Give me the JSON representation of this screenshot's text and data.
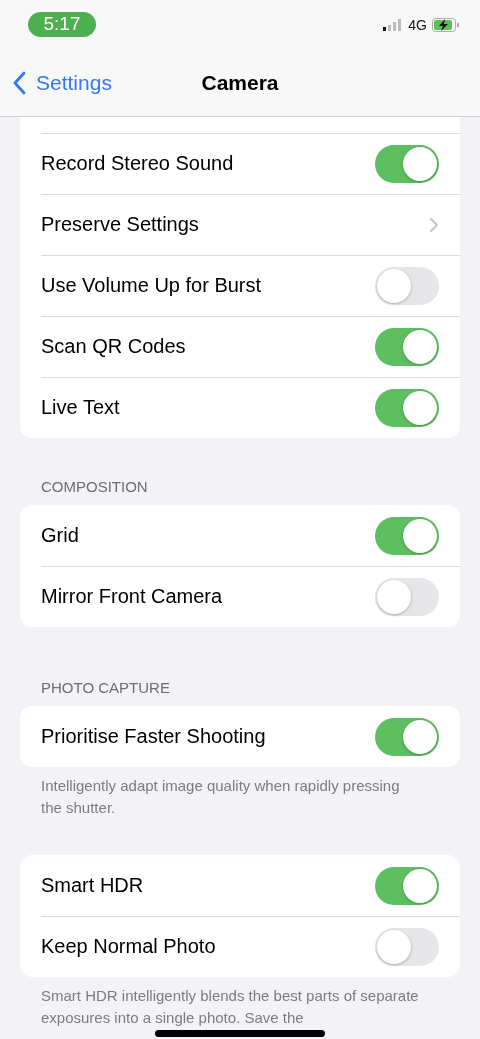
{
  "status_bar": {
    "time": "5:17",
    "network": "4G"
  },
  "nav": {
    "back": "Settings",
    "title": "Camera"
  },
  "groups": [
    {
      "rows": [
        {
          "label": "Record Stereo Sound",
          "kind": "toggle",
          "on": true
        },
        {
          "label": "Preserve Settings",
          "kind": "link"
        },
        {
          "label": "Use Volume Up for Burst",
          "kind": "toggle",
          "on": false
        },
        {
          "label": "Scan QR Codes",
          "kind": "toggle",
          "on": true
        },
        {
          "label": "Live Text",
          "kind": "toggle",
          "on": true
        }
      ]
    },
    {
      "header": "COMPOSITION",
      "rows": [
        {
          "label": "Grid",
          "kind": "toggle",
          "on": true
        },
        {
          "label": "Mirror Front Camera",
          "kind": "toggle",
          "on": false
        }
      ]
    },
    {
      "header": "PHOTO CAPTURE",
      "rows": [
        {
          "label": "Prioritise Faster Shooting",
          "kind": "toggle",
          "on": true
        }
      ],
      "footer": "Intelligently adapt image quality when rapidly pressing the shutter."
    },
    {
      "rows": [
        {
          "label": "Smart HDR",
          "kind": "toggle",
          "on": true
        },
        {
          "label": "Keep Normal Photo",
          "kind": "toggle",
          "on": false
        }
      ],
      "footer": "Smart HDR intelligently blends the best parts of separate exposures into a single photo. Save the"
    }
  ]
}
